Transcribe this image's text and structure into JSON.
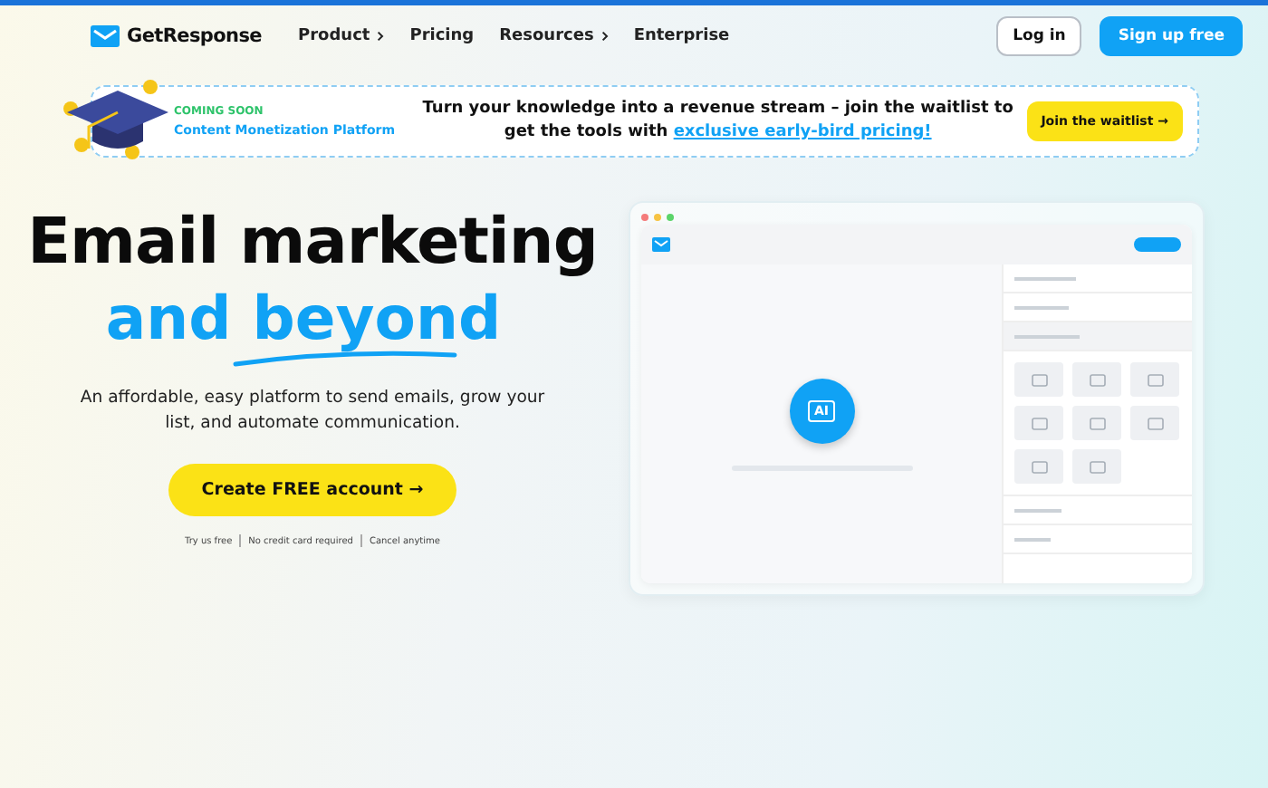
{
  "nav": {
    "brand": "GetResponse",
    "links": [
      {
        "label": "Product",
        "dropdown": true
      },
      {
        "label": "Pricing",
        "dropdown": false
      },
      {
        "label": "Resources",
        "dropdown": true
      },
      {
        "label": "Enterprise",
        "dropdown": false
      }
    ],
    "login": "Log in",
    "signup": "Sign up free"
  },
  "banner": {
    "eyebrow": "COMING SOON",
    "product": "Content Monetization Platform",
    "message": "Turn your knowledge into a revenue stream – join the waitlist to get the tools with",
    "link": "exclusive early-bird pricing!",
    "button": "Join the waitlist →"
  },
  "hero": {
    "title": "Email marketing",
    "accent": "and beyond",
    "subtitle": "An affordable, easy platform to send emails, grow your list, and automate communication.",
    "cta": "Create FREE account →",
    "notes": [
      "Try us free",
      "No credit card required",
      "Cancel anytime"
    ]
  },
  "mockup": {
    "ai_label": "AI"
  }
}
